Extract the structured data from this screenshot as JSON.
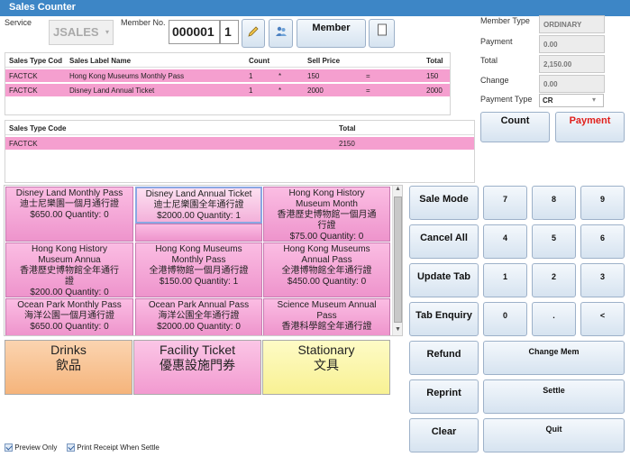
{
  "window": {
    "title": "Sales Counter"
  },
  "header": {
    "service_label": "Service",
    "service_value": "JSALES",
    "member_no_label": "Member No.",
    "member_no_value": "000001",
    "member_no_suffix": "1",
    "member_button": "Member"
  },
  "summary": {
    "member_type_label": "Member Type",
    "member_type_value": "ORDINARY",
    "payment_label": "Payment",
    "payment_value": "0.00",
    "total_label": "Total",
    "total_value": "2,150.00",
    "change_label": "Change",
    "change_value": "0.00",
    "payment_type_label": "Payment Type",
    "payment_type_value": "CR",
    "count_button": "Count",
    "payment_button": "Payment",
    "payment_color": "#e0201c"
  },
  "lines_table": {
    "headers": [
      "Sales Type Cod",
      "Sales Label Name",
      "Count",
      "",
      "Sell Price",
      "",
      "Total"
    ],
    "rows": [
      [
        "FACTCK",
        "Hong Kong Museums Monthly Pass",
        "1",
        "*",
        "150",
        "=",
        "150"
      ],
      [
        "FACTCK",
        "Disney Land Annual Ticket",
        "1",
        "*",
        "2000",
        "=",
        "2000"
      ]
    ]
  },
  "summary_table": {
    "headers": [
      "Sales Type Code",
      "Total"
    ],
    "rows": [
      [
        "FACTCK",
        "2150"
      ]
    ]
  },
  "products": [
    {
      "l1": "Disney Land Monthly Pass",
      "l2": "迪士尼樂園一個月通行證",
      "l3": "$650.00 Quantity: 0",
      "l4": ""
    },
    {
      "l1": "Disney Land Annual Ticket",
      "l2": "迪士尼樂園全年通行證",
      "l3": "$2000.00 Quantity: 1",
      "l4": ""
    },
    {
      "l1": "Hong Kong History",
      "l2": "Museum Month",
      "l3": "香港歷史博物館一個月通",
      "l4": "行證",
      "l5": "$75.00 Quantity: 0"
    },
    {
      "l1": "Hong Kong History",
      "l2": "Museum Annua",
      "l3": "香港歷史博物館全年通行",
      "l4": "證",
      "l5": "$200.00 Quantity: 0"
    },
    {
      "l1": "Hong Kong Museums",
      "l2": "Monthly Pass",
      "l3": "全港博物館一個月通行證",
      "l4": "$150.00 Quantity: 1"
    },
    {
      "l1": "Hong Kong Museums",
      "l2": "Annual Pass",
      "l3": "全港博物館全年通行證",
      "l4": "$450.00 Quantity: 0"
    },
    {
      "l1": "Ocean Park Monthly Pass",
      "l2": "海洋公園一個月通行證",
      "l3": "$650.00 Quantity: 0",
      "l4": ""
    },
    {
      "l1": "Ocean Park Annual Pass",
      "l2": "海洋公園全年通行證",
      "l3": "$2000.00 Quantity: 0",
      "l4": ""
    },
    {
      "l1": "Science Museum Annual",
      "l2": "Pass",
      "l3": "香港科學館全年通行證",
      "l4": ""
    }
  ],
  "categories": [
    {
      "en": "Drinks",
      "zh": "飲品",
      "color_top": "#fbd4b0",
      "color_bottom": "#f5b47b"
    },
    {
      "en": "Facility Ticket",
      "zh": "優惠設施門券",
      "color_top": "#fbc6e6",
      "color_bottom": "#f29ad0"
    },
    {
      "en": "Stationary",
      "zh": "文具",
      "color_top": "#fefbc6",
      "color_bottom": "#f8f193"
    }
  ],
  "actions": {
    "sale_mode": "Sale Mode",
    "cancel_all": "Cancel All",
    "update_tab": "Update Tab",
    "tab_enquiry": "Tab Enquiry",
    "refund": "Refund",
    "reprint": "Reprint",
    "clear": "Clear",
    "change_mem": "Change Mem",
    "settle": "Settle",
    "quit": "Quit"
  },
  "keypad": [
    "7",
    "8",
    "9",
    "4",
    "5",
    "6",
    "1",
    "2",
    "3",
    "0",
    ".",
    "<"
  ],
  "footer": {
    "preview_only": "Preview Only",
    "print_receipt": "Print Receipt When Settle"
  }
}
